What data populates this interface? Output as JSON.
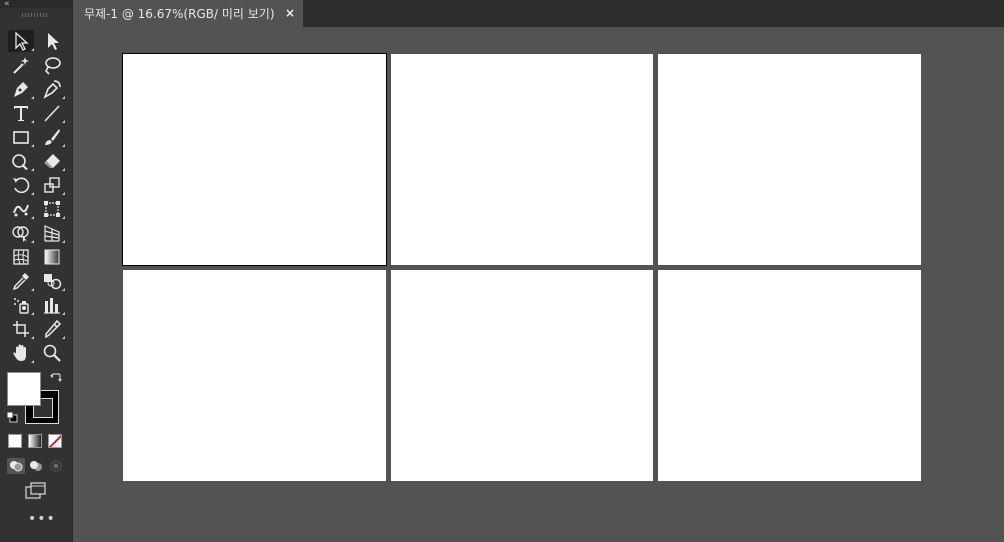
{
  "document_tab": {
    "title": "무제-1 @ 16.67%(RGB/ 미리 보기)",
    "close_glyph": "×"
  },
  "toolbar": {
    "collapse_glyph": "«",
    "tools": [
      {
        "name": "selection-tool-icon"
      },
      {
        "name": "direct-selection-tool-icon"
      },
      {
        "name": "magic-wand-tool-icon"
      },
      {
        "name": "lasso-tool-icon"
      },
      {
        "name": "pen-tool-icon"
      },
      {
        "name": "curvature-tool-icon"
      },
      {
        "name": "type-tool-icon"
      },
      {
        "name": "line-segment-tool-icon"
      },
      {
        "name": "rectangle-tool-icon"
      },
      {
        "name": "paintbrush-tool-icon"
      },
      {
        "name": "shaper-tool-icon"
      },
      {
        "name": "eraser-tool-icon"
      },
      {
        "name": "rotate-tool-icon"
      },
      {
        "name": "scale-tool-icon"
      },
      {
        "name": "puppet-warp-tool-icon"
      },
      {
        "name": "free-transform-tool-icon"
      },
      {
        "name": "shape-builder-tool-icon"
      },
      {
        "name": "perspective-grid-tool-icon"
      },
      {
        "name": "mesh-tool-icon"
      },
      {
        "name": "gradient-tool-icon"
      },
      {
        "name": "eyedropper-tool-icon"
      },
      {
        "name": "blend-tool-icon"
      },
      {
        "name": "symbol-sprayer-tool-icon"
      },
      {
        "name": "column-graph-tool-icon"
      },
      {
        "name": "artboard-tool-icon"
      },
      {
        "name": "slice-tool-icon"
      },
      {
        "name": "hand-tool-icon"
      },
      {
        "name": "zoom-tool-icon"
      }
    ],
    "fill_color": "#ffffff",
    "stroke_color": "#000000",
    "more_glyph": "•••"
  },
  "canvas": {
    "background": "#535353",
    "artboard_rows": 2,
    "artboard_cols": 3,
    "selected_artboard_index": 0
  }
}
